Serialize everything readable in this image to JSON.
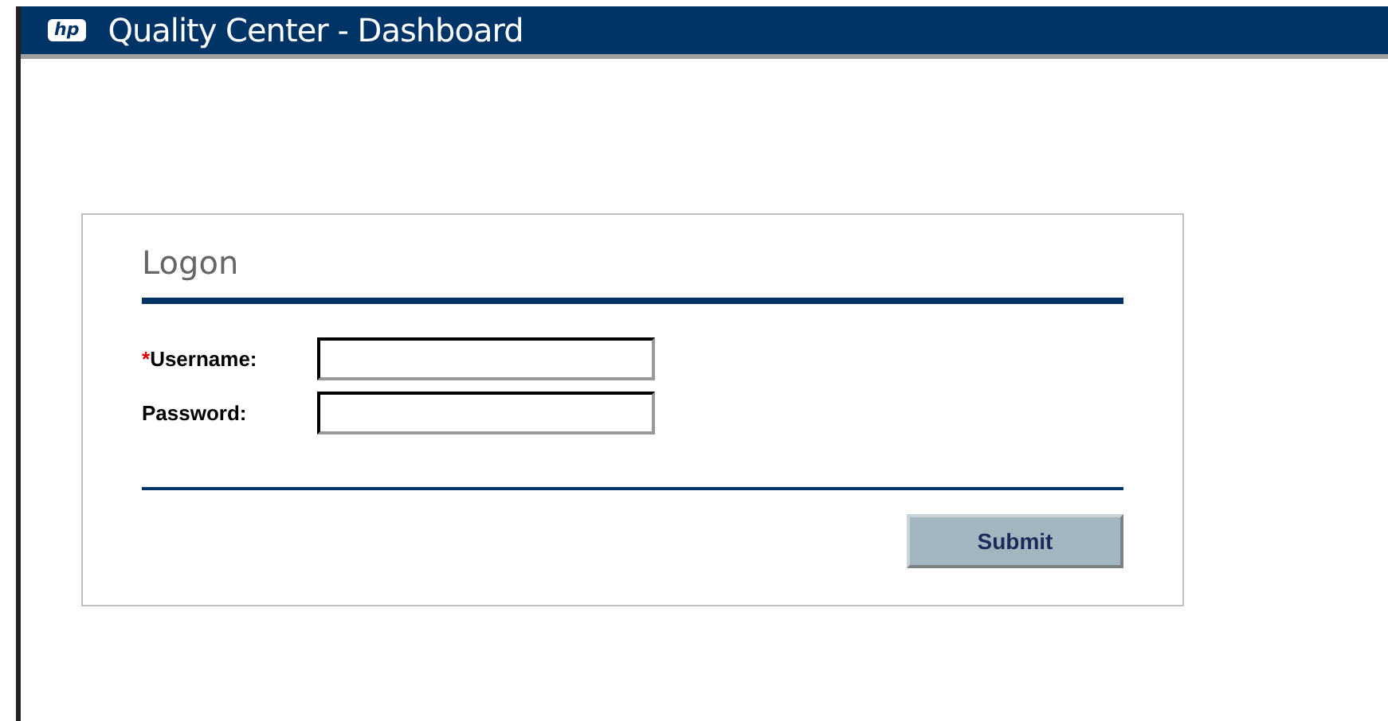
{
  "window": {
    "logo": "hp",
    "title": "Quality Center - Dashboard"
  },
  "logon": {
    "heading": "Logon",
    "fields": [
      {
        "required_mark": "*",
        "label": "Username:"
      },
      {
        "label": "Password:"
      }
    ],
    "submit": "Submit"
  }
}
